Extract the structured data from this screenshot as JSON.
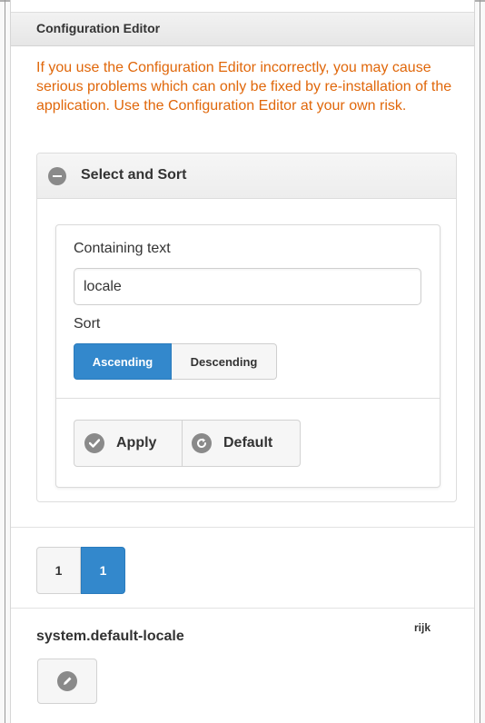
{
  "header": {
    "title": "Configuration Editor"
  },
  "warning": "If you use the Configuration Editor incorrectly, you may cause serious problems which can only be fixed by re-installation of the application. Use the Configuration Editor at your own risk.",
  "select_sort": {
    "title": "Select and Sort",
    "containing_label": "Containing text",
    "containing_value": "locale",
    "sort_label": "Sort",
    "sort_options": [
      "Ascending",
      "Descending"
    ],
    "sort_selected": "Ascending",
    "apply_label": "Apply",
    "default_label": "Default"
  },
  "pager": {
    "pages": [
      "1",
      "1"
    ],
    "active_index": 1
  },
  "item": {
    "key": "system.default-locale",
    "value": "rijk"
  },
  "colors": {
    "accent": "#3388cc",
    "warning": "#e0670a",
    "icon_gray": "#8a8a8a"
  },
  "icons": {
    "collapse": "minus-circle-icon",
    "apply": "check-circle-icon",
    "default": "refresh-icon",
    "edit": "pencil-icon"
  }
}
